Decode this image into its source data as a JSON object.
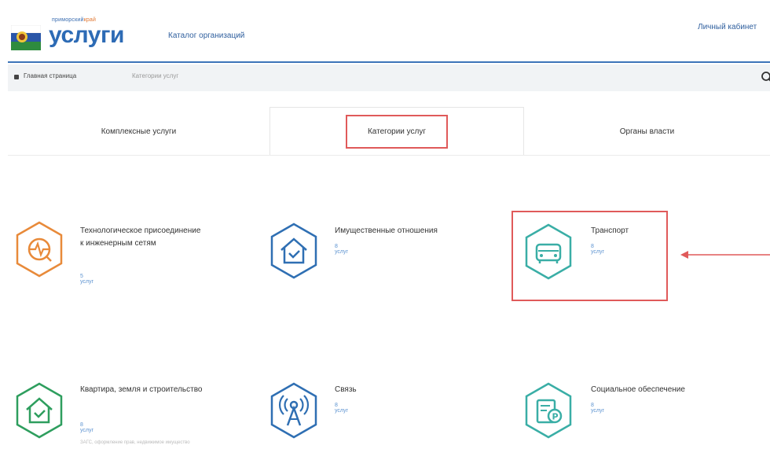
{
  "header": {
    "logo_small": "приморский",
    "logo_small_accent": "край",
    "logo_big": "услуги",
    "catalog_link": "Каталог организаций",
    "cabinet_link": "Личный кабинет"
  },
  "breadcrumb": {
    "home": "Главная страница",
    "current": "Категории услуг"
  },
  "tabs": [
    {
      "label": "Комплексные услуги"
    },
    {
      "label": "Категории услуг"
    },
    {
      "label": "Органы власти"
    }
  ],
  "categories": [
    {
      "title": "Технологическое присоединение к инженерным сетям",
      "count": "5 услуг",
      "icon": "tech-connection-icon",
      "color": "#e88a3a"
    },
    {
      "title": "Имущественные отношения",
      "count": "8 услуг",
      "icon": "house-check-icon",
      "color": "#2f6fb3"
    },
    {
      "title": "Транспорт",
      "count": "8 услуг",
      "icon": "car-icon",
      "color": "#3aaea6"
    },
    {
      "title": "Квартира, земля и строительство",
      "count": "8 услуг",
      "extra": "ЗАГС, оформление прав, недвижимое имущество",
      "icon": "house-check-icon",
      "color": "#2e9e5e"
    },
    {
      "title": "Связь",
      "count": "8 услуг",
      "icon": "antenna-icon",
      "color": "#2f6fb3"
    },
    {
      "title": "Социальное обеспечение",
      "count": "8 услуг",
      "icon": "parking-doc-icon",
      "color": "#3aaea6"
    }
  ],
  "colors": {
    "accent_blue": "#2d6bb5",
    "highlight_red": "#e05a5a"
  }
}
